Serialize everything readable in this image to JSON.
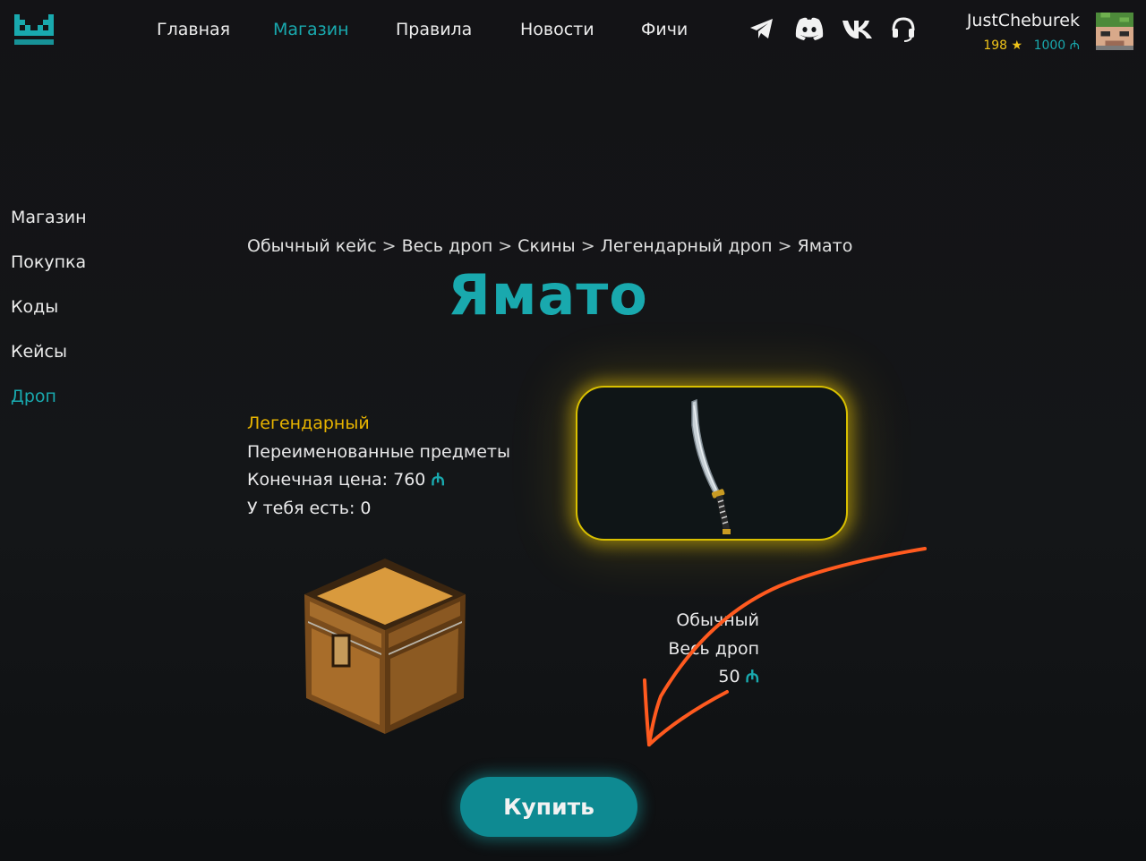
{
  "header": {
    "nav": [
      "Главная",
      "Магазин",
      "Правила",
      "Новости",
      "Фичи"
    ],
    "active_nav": "Магазин",
    "social_icons": [
      "telegram-icon",
      "discord-icon",
      "vk-icon",
      "support-headset-icon"
    ],
    "user": {
      "name": "JustCheburek",
      "stars": "198",
      "coins": "1000"
    },
    "currency_symbol": "₼"
  },
  "sidebar": {
    "items": [
      "Магазин",
      "Покупка",
      "Коды",
      "Кейсы",
      "Дроп"
    ],
    "active": "Дроп"
  },
  "breadcrumb": [
    "Обычный кейс",
    "Весь дроп",
    "Скины",
    "Легендарный дроп",
    "Ямато"
  ],
  "breadcrumb_sep": ">",
  "item": {
    "title": "Ямато",
    "rarity": "Легендарный",
    "category": "Переименованные предметы",
    "price_label": "Конечная цена: 760",
    "owned_label": "У тебя есть: 0"
  },
  "case": {
    "name": "Обычный",
    "drop": "Весь дроп",
    "price": "50"
  },
  "buy_button": "Купить",
  "colors": {
    "accent": "#19a9ae",
    "legendary": "#e8b400",
    "background": "#131316",
    "annotation_arrow": "#ff5a1f"
  }
}
